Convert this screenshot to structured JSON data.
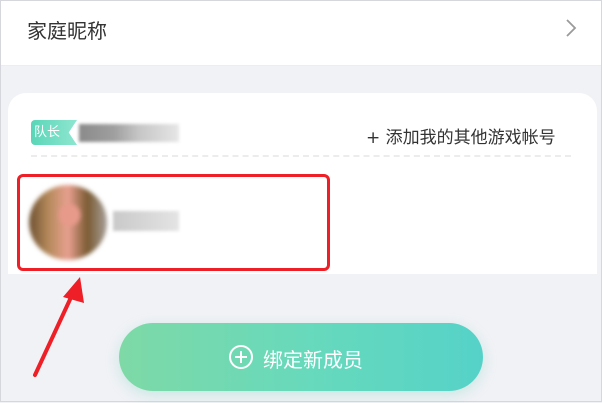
{
  "header": {
    "title": "家庭昵称",
    "chevron_icon": "chevron-right-icon"
  },
  "card": {
    "captain_badge": "队长",
    "add_account_label": "+ 添加我的其他游戏帐号"
  },
  "bind_button": {
    "icon": "plus-circle-icon",
    "label": "绑定新成员"
  },
  "colors": {
    "accent_start": "#7ed9a6",
    "accent_end": "#55d2c8",
    "highlight": "#ee1f26"
  }
}
